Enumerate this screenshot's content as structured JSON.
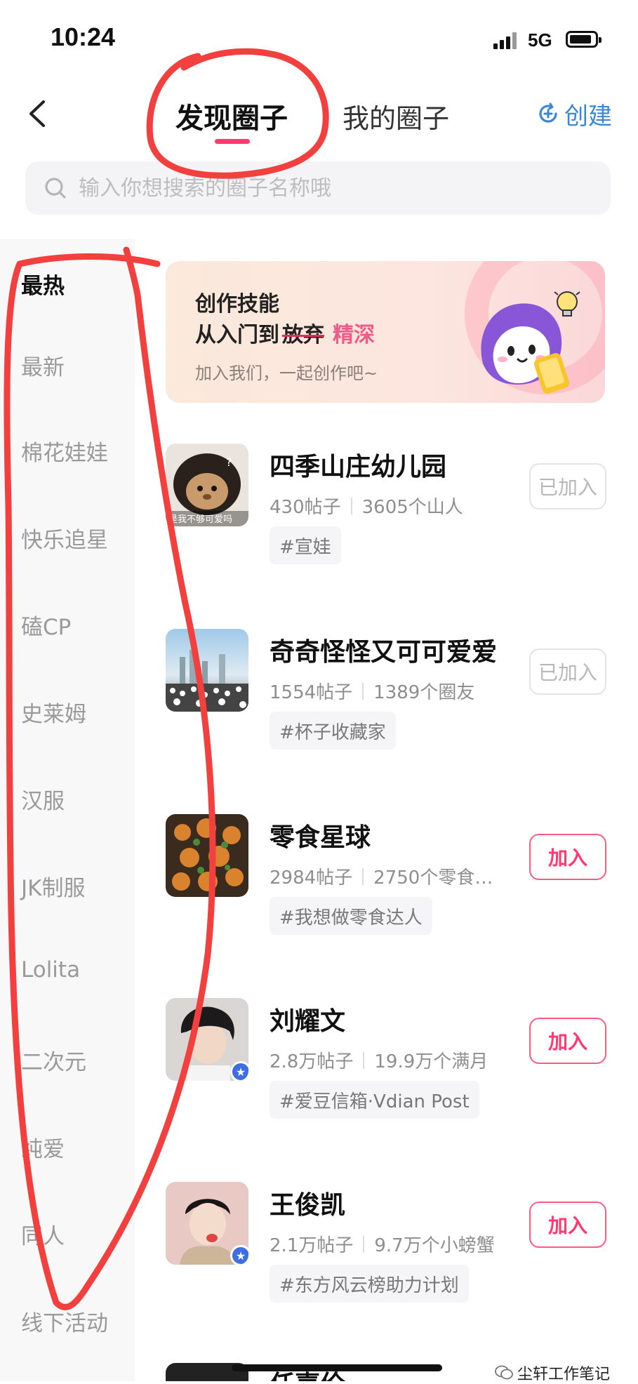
{
  "status": {
    "time": "10:24",
    "network": "5G"
  },
  "header": {
    "tab_discover": "发现圈子",
    "tab_mine": "我的圈子",
    "create_label": "创建"
  },
  "search": {
    "placeholder": "输入你想搜索的圈子名称哦"
  },
  "sidebar": {
    "items": [
      {
        "label": "最热"
      },
      {
        "label": "最新"
      },
      {
        "label": "棉花娃娃"
      },
      {
        "label": "快乐追星"
      },
      {
        "label": "磕CP"
      },
      {
        "label": "史莱姆"
      },
      {
        "label": "汉服"
      },
      {
        "label": "JK制服"
      },
      {
        "label": "Lolita"
      },
      {
        "label": "二次元"
      },
      {
        "label": "纯爱"
      },
      {
        "label": "同人"
      },
      {
        "label": "线下活动"
      }
    ]
  },
  "banner": {
    "line1": "创作技能",
    "line2_prefix": "从入门到",
    "line2_strike": "放弃",
    "line2_pink": "精深",
    "subtitle": "加入我们，一起创作吧~"
  },
  "circles": [
    {
      "name": "四季山庄幼儿园",
      "posts": "430帖子",
      "members": "3605个山人",
      "tag": "#宣娃",
      "button": "已加入",
      "avatar_caption": "是我不够可爱吗"
    },
    {
      "name": "奇奇怪怪又可可爱爱",
      "posts": "1554帖子",
      "members": "1389个圈友",
      "tag": "#杯子收藏家",
      "button": "已加入"
    },
    {
      "name": "零食星球",
      "posts": "2984帖子",
      "members": "2750个零食…",
      "tag": "#我想做零食达人",
      "button": "加入"
    },
    {
      "name": "刘耀文",
      "posts": "2.8万帖子",
      "members": "19.9万个满月",
      "tag": "#爱豆信箱·Vdian Post",
      "button": "加入"
    },
    {
      "name": "王俊凯",
      "posts": "2.1万帖子",
      "members": "9.7万个小螃蟹",
      "tag": "#东方风云榜助力计划",
      "button": "加入"
    },
    {
      "name": "任嘉伦"
    }
  ],
  "watermark": "尘轩工作笔记",
  "colors": {
    "accent": "#ff3a6f",
    "create_blue": "#3a86d8",
    "annotation_red": "#f2403f"
  }
}
